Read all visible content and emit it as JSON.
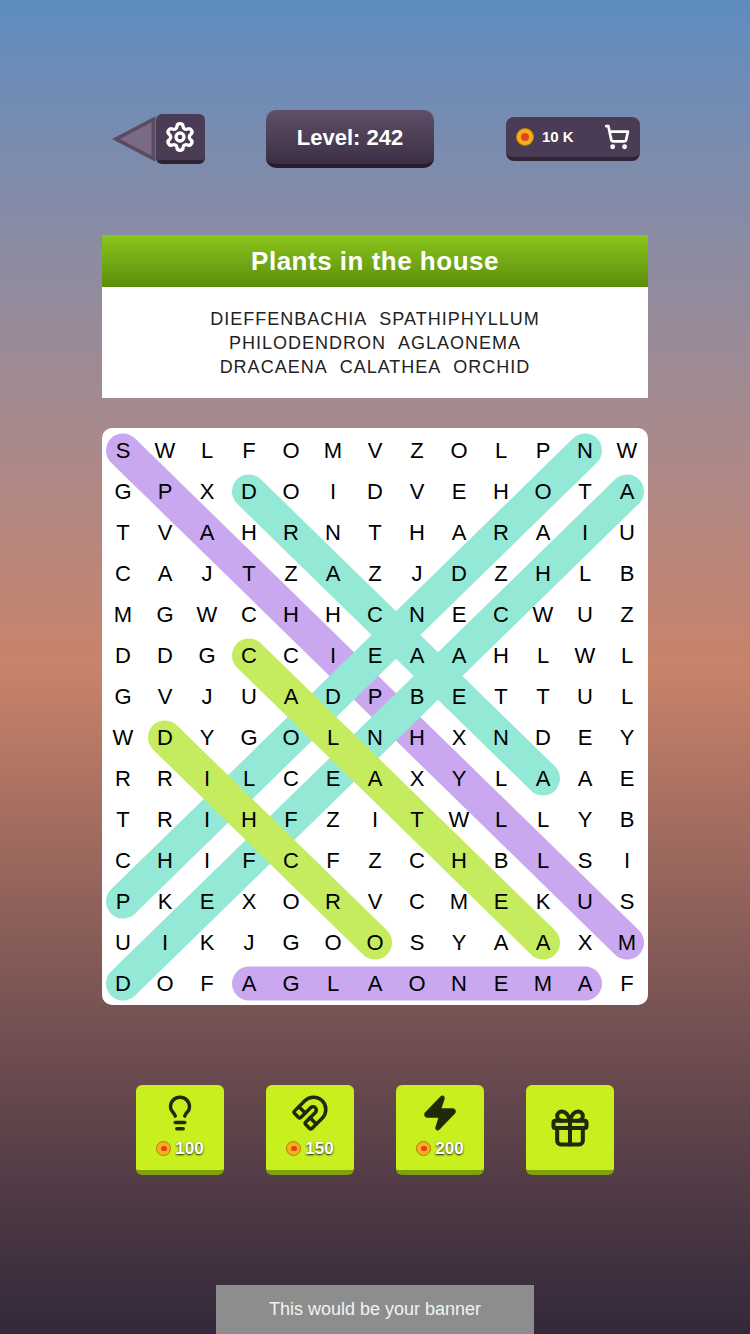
{
  "level": "Level: 242",
  "coins": "10 K",
  "category": "Plants in the house",
  "word_rows": [
    [
      "DIEFFENBACHIA",
      "SPATHIPHYLLUM"
    ],
    [
      "PHILODENDRON",
      "AGLAONEMA"
    ],
    [
      "DRACAENA",
      "CALATHEA",
      "ORCHID"
    ]
  ],
  "grid": [
    "SWLFOMVZOLPNW",
    "GPXDOIDVEHOTA",
    "TVAHRNTHARAIU",
    "CAJTZAZJDZHLB",
    "MGWCHHCNECWUZ",
    "DDGCCIEAAHLWL",
    "GVJUADPBETTUL",
    "WDYGOLNHXNDEY",
    "RRILCEAXYLAAE",
    "TRIHFZITWLLYB",
    "CHIFCFZCHBLSI",
    "PKEXORVCMEKUS",
    "UIKJGOOSYAAXM",
    "DOFAGLAONEMAF"
  ],
  "found": [
    {
      "start": [
        0,
        0
      ],
      "end": [
        12,
        12
      ],
      "color": "#c9a8f0"
    },
    {
      "start": [
        1,
        3
      ],
      "end": [
        8,
        10
      ],
      "color": "#94e8d6"
    },
    {
      "start": [
        11,
        0
      ],
      "end": [
        0,
        11
      ],
      "color": "#94e8d6"
    },
    {
      "start": [
        13,
        0
      ],
      "end": [
        1,
        12
      ],
      "color": "#94e8d6"
    },
    {
      "start": [
        5,
        3
      ],
      "end": [
        12,
        10
      ],
      "color": "#c4ec5e"
    },
    {
      "start": [
        12,
        6
      ],
      "end": [
        7,
        1
      ],
      "color": "#c4ec5e"
    },
    {
      "start": [
        13,
        3
      ],
      "end": [
        13,
        11
      ],
      "color": "#c9a8f0"
    }
  ],
  "powerups": [
    {
      "kind": "hint",
      "cost": "100"
    },
    {
      "kind": "magnet",
      "cost": "150"
    },
    {
      "kind": "lightning",
      "cost": "200"
    },
    {
      "kind": "video",
      "cost": ""
    }
  ],
  "banner": "This would be your banner"
}
